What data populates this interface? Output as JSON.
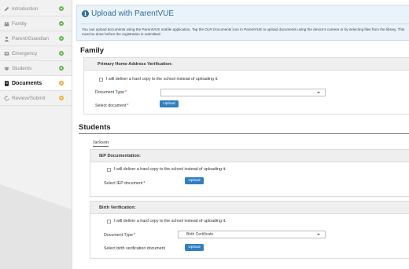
{
  "sidebar": {
    "items": [
      {
        "label": "Introduction",
        "icon": "pencil-icon",
        "status": "complete",
        "active": false
      },
      {
        "label": "Family",
        "icon": "family-icon",
        "status": "complete",
        "active": false
      },
      {
        "label": "Parent/Guardian",
        "icon": "person-icon",
        "status": "complete",
        "active": false
      },
      {
        "label": "Emergency",
        "icon": "phone-book-icon",
        "status": "complete",
        "active": false
      },
      {
        "label": "Students",
        "icon": "graduation-cap-icon",
        "status": "complete",
        "active": false
      },
      {
        "label": "Documents",
        "icon": "document-icon",
        "status": "incomplete",
        "active": true
      },
      {
        "label": "Review/Submit",
        "icon": "refresh-icon",
        "status": "incomplete",
        "active": false
      }
    ],
    "colors": {
      "complete": "#62b84a",
      "incomplete": "#f0ad3a"
    }
  },
  "info": {
    "title": "Upload with ParentVUE",
    "text": "You can upload documents using the ParentVUE mobile application. Tap the OLR Documents icon in ParentVUE to upload documents using the device's camera or by selecting files from the library. This must be done before the registration is submitted."
  },
  "family": {
    "title": "Family",
    "card": {
      "header": "Primary Home Address Verification:",
      "hardcopy_label": "I will deliver a hard copy to the school instead of uploading it.",
      "doc_type_label": "Document Type",
      "doc_type_value": "",
      "select_label": "Select document",
      "upload_label": "Upload"
    }
  },
  "students": {
    "title": "Students",
    "student_name": "Jackson",
    "iep": {
      "header": "IEP Documentation:",
      "hardcopy_label": "I will deliver a hard copy to the school instead of uploading it.",
      "select_label": "Select IEP document",
      "upload_label": "Upload"
    },
    "birth": {
      "header": "Birth Verification:",
      "hardcopy_label": "I will deliver a hard copy to the school instead of uploading it.",
      "doc_type_label": "Document Type",
      "doc_type_value": "Birth Certificate",
      "select_label": "Select birth verification document",
      "upload_label": "Upload"
    }
  },
  "required_mark": "*"
}
